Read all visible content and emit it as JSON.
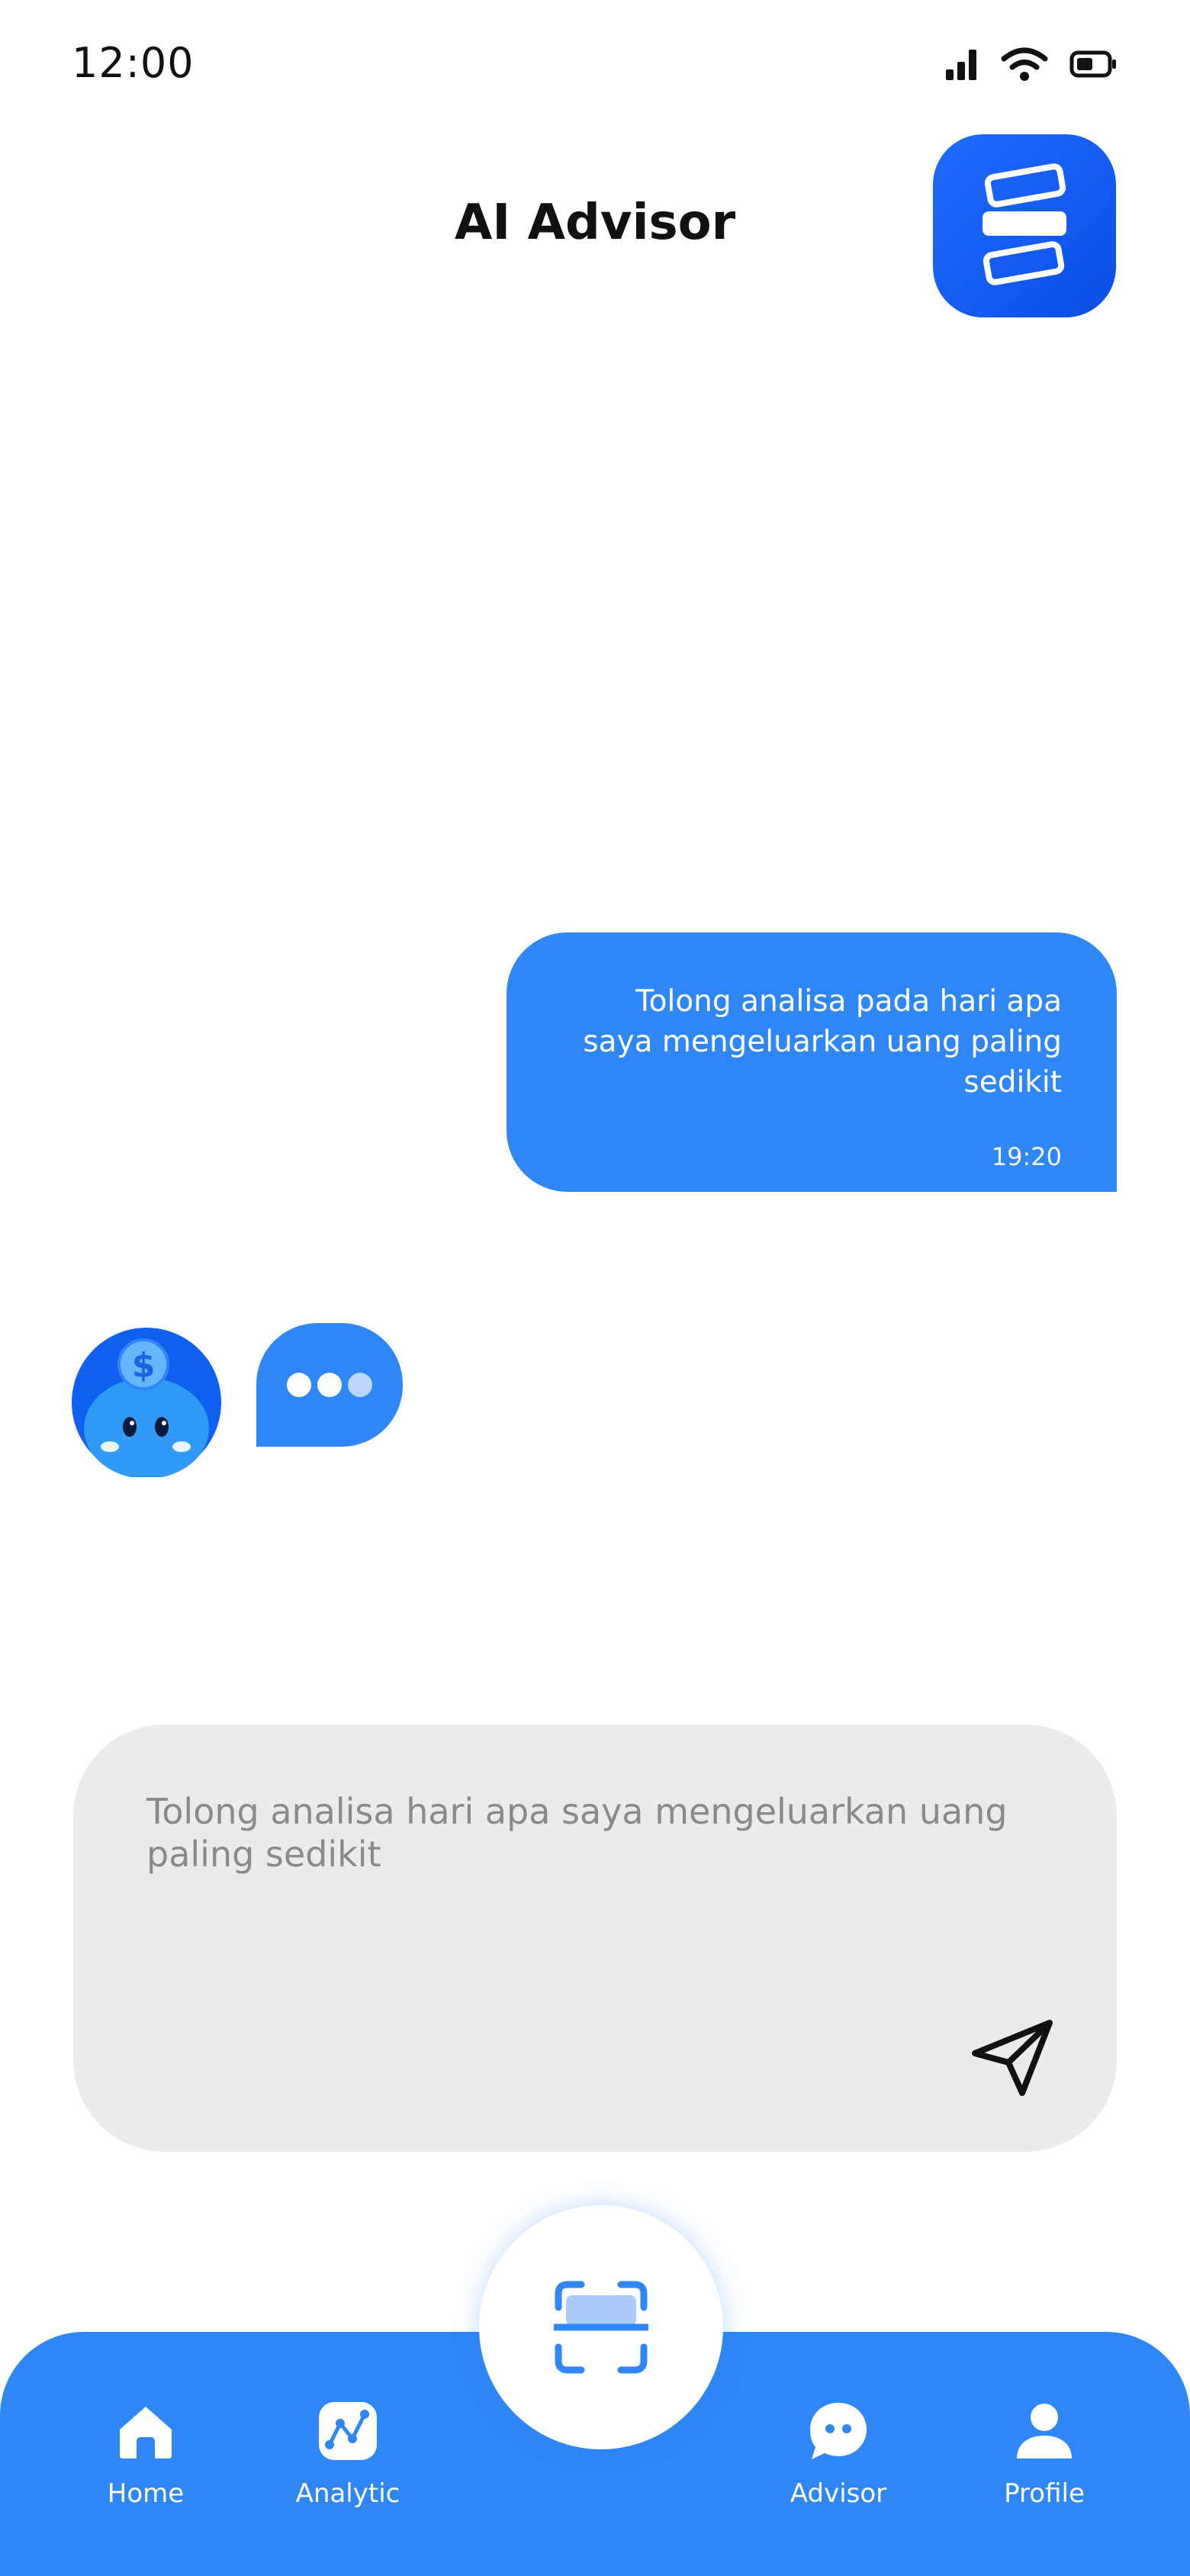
{
  "status_bar": {
    "time": "12:00",
    "icons": [
      "signal-icon",
      "wifi-icon",
      "battery-icon"
    ]
  },
  "header": {
    "title": "AI Advisor",
    "menu_icon": "menu-icon"
  },
  "chat": {
    "user_message": {
      "text": "Tolong analisa pada hari apa saya mengeluarkan uang paling sedikit",
      "time": "19:20"
    },
    "bot": {
      "avatar_icon": "piggy-bank-avatar-icon",
      "typing_indicator": "typing-dots-icon"
    }
  },
  "composer": {
    "text": "Tolong analisa hari apa saya mengeluarkan uang paling sedikit",
    "send_icon": "send-icon"
  },
  "bottom_nav": {
    "items": [
      {
        "label": "Home",
        "icon": "home-icon"
      },
      {
        "label": "Analytic",
        "icon": "analytic-icon"
      },
      {
        "label": "Advisor",
        "icon": "chat-icon"
      },
      {
        "label": "Profile",
        "icon": "profile-icon"
      }
    ],
    "center_icon": "scan-icon"
  },
  "colors": {
    "primary": "#2f86f6",
    "primary_dark": "#0a4fe8",
    "input_bg": "#ebebeb",
    "placeholder_text": "#8a8a8a"
  }
}
